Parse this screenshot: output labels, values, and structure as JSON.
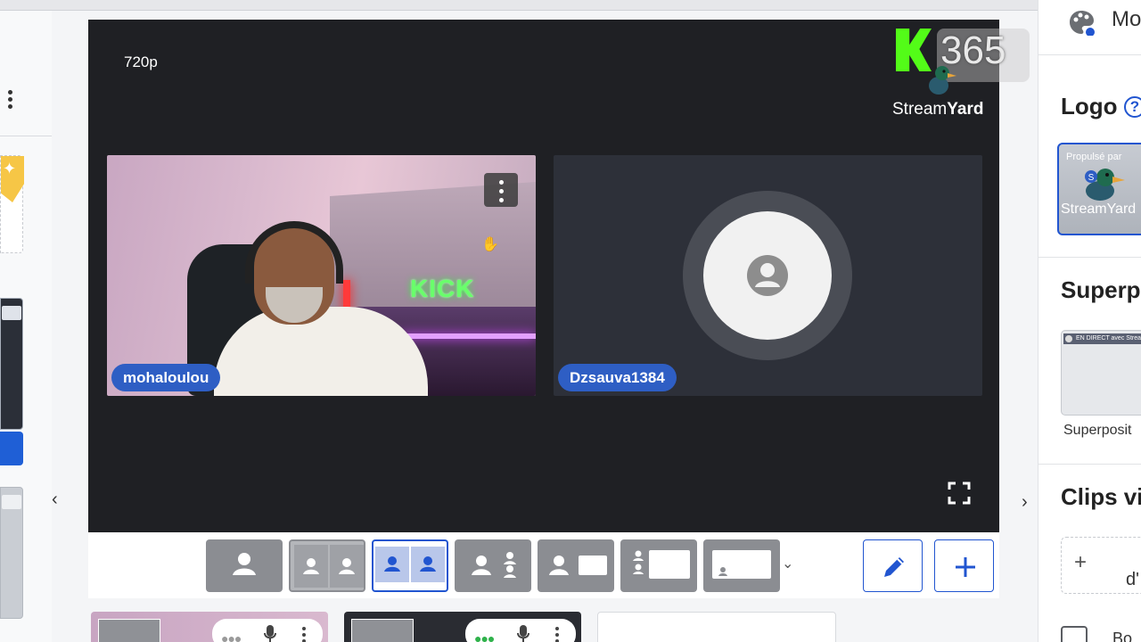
{
  "stage": {
    "resolution": "720p",
    "watermark_number": "365",
    "brand_text_left": "Stream",
    "brand_text_right": "Yard",
    "participants": [
      {
        "name": "mohaloulou",
        "camera_on": true
      },
      {
        "name": "Dzsauva1384",
        "camera_on": false
      }
    ],
    "cam_sign_text": "KICK"
  },
  "layout_bar": {
    "layouts": [
      "solo",
      "two-grey",
      "two-selected",
      "one-plus-list",
      "one-and-screen",
      "list-and-screen",
      "screen-only"
    ],
    "selected_index": 2
  },
  "right_panel": {
    "header_label": "Mo",
    "logo_title": "Logo",
    "logo_card_top": "Propulsé par",
    "logo_card_brand": "StreamYard",
    "overlay_title": "Superp",
    "overlay_bar_text": "EN DIRECT avec StreamYard",
    "overlay_caption": "Superposit",
    "clips_title": "Clips vi",
    "clip_card_text": "d'",
    "checkbox_label": "Bo"
  },
  "colors": {
    "accent": "#2155d0",
    "name_tag": "#2e5ec4",
    "stage_bg": "#1f2024",
    "kick_green": "#53fc18"
  }
}
